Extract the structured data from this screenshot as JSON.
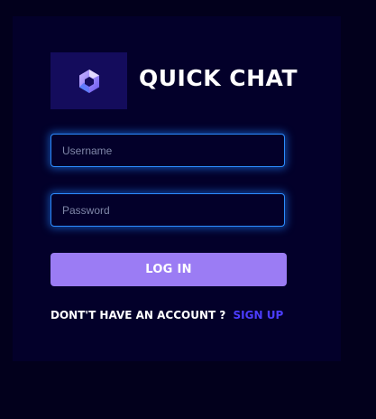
{
  "app": {
    "title": "QUICK CHAT",
    "logo_icon": "hexagon-logo-icon"
  },
  "form": {
    "username_placeholder": "Username",
    "password_placeholder": "Password",
    "login_label": "LOG IN"
  },
  "footer": {
    "prompt_text": "DONT'T HAVE AN ACCOUNT ?",
    "signup_label": "SIGN UP"
  },
  "colors": {
    "page_background": "#02001c",
    "card_background": "#03002a",
    "logo_background": "#140c5c",
    "input_glow": "#2d8cff",
    "button": "#9b7cf4",
    "signup_link": "#4c3dff"
  }
}
